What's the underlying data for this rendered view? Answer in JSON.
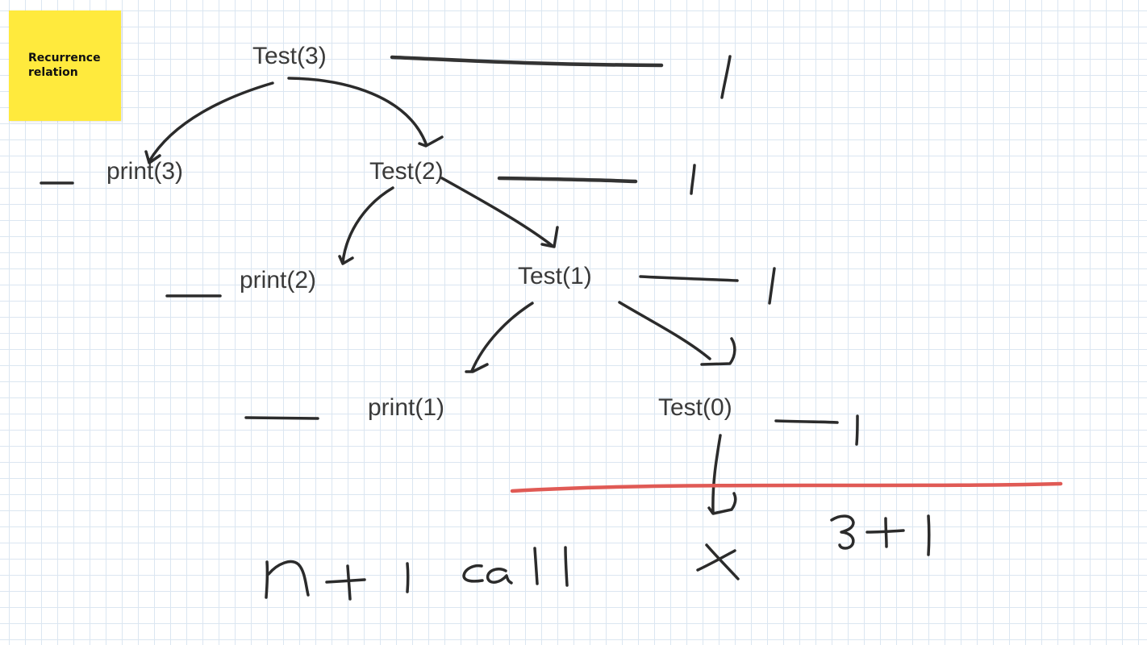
{
  "sticky_note": {
    "text": "Recurrence\nrelation",
    "color": "#ffea3d"
  },
  "tree": {
    "nodes": {
      "test3": "Test(3)",
      "print3": "print(3)",
      "test2": "Test(2)",
      "print2": "print(2)",
      "test1": "Test(1)",
      "print1": "print(1)",
      "test0": "Test(0)"
    }
  },
  "handwriting": {
    "cost_marks": [
      "1",
      "1",
      "1",
      "1"
    ],
    "terminal_mark": "X",
    "sum": "3 + 1",
    "total": "n + 1 call"
  },
  "colors": {
    "ink": "#2b2b2b",
    "text": "#3a3a3a",
    "red_line": "#e05a55",
    "grid": "#dbe6f1"
  }
}
